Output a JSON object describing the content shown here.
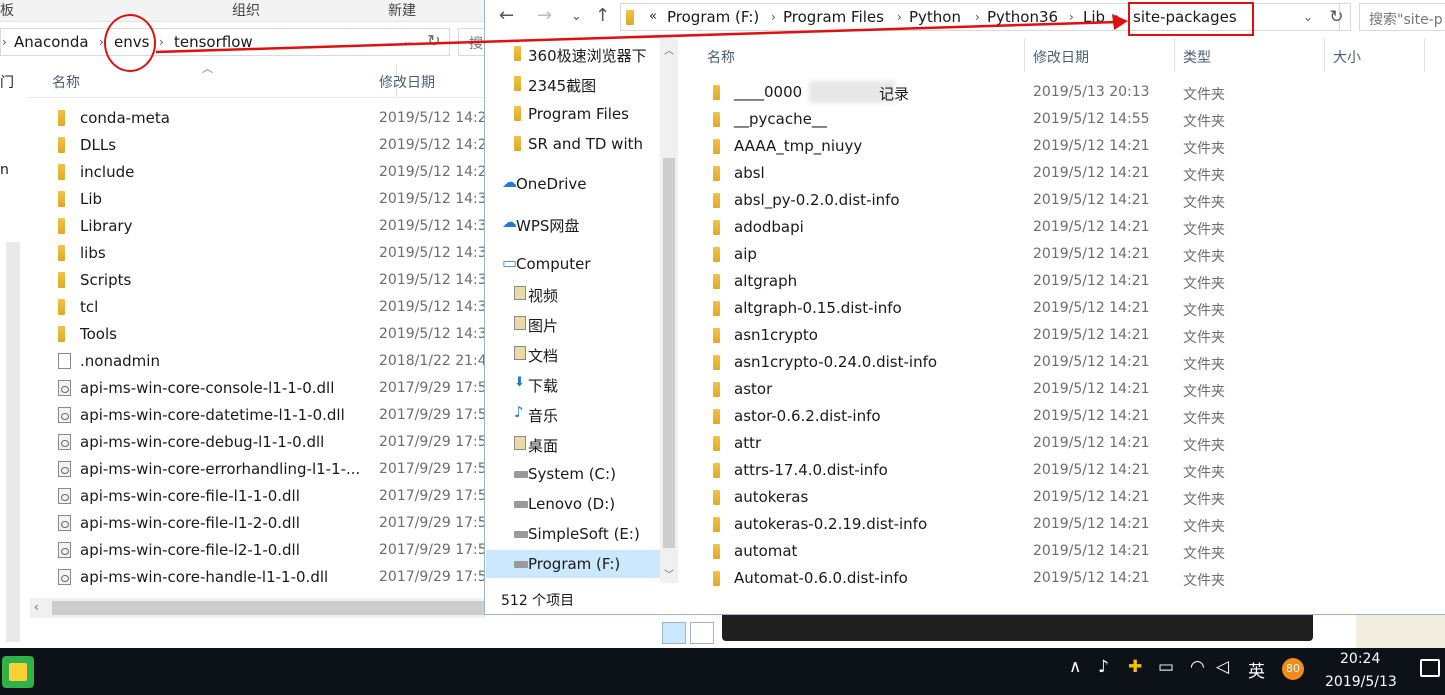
{
  "back_window": {
    "ribbon": {
      "left_partial": "板",
      "group": "组织",
      "new": "新建"
    },
    "breadcrumb": [
      "Anaconda",
      "envs",
      "tensorflow"
    ],
    "search_partial": "搜",
    "left_strip": {
      "top": "门",
      "mid": "n"
    },
    "columns": {
      "name": "名称",
      "date": "修改日期"
    },
    "rows": [
      {
        "name": "conda-meta",
        "date": "2019/5/12 14:2",
        "type": "folder"
      },
      {
        "name": "DLLs",
        "date": "2019/5/12 14:2",
        "type": "folder"
      },
      {
        "name": "include",
        "date": "2019/5/12 14:2",
        "type": "folder"
      },
      {
        "name": "Lib",
        "date": "2019/5/12 14:3",
        "type": "folder"
      },
      {
        "name": "Library",
        "date": "2019/5/12 14:3",
        "type": "folder"
      },
      {
        "name": "libs",
        "date": "2019/5/12 14:3",
        "type": "folder"
      },
      {
        "name": "Scripts",
        "date": "2019/5/12 14:3",
        "type": "folder"
      },
      {
        "name": "tcl",
        "date": "2019/5/12 14:3",
        "type": "folder"
      },
      {
        "name": "Tools",
        "date": "2019/5/12 14:3",
        "type": "folder"
      },
      {
        "name": ".nonadmin",
        "date": "2018/1/22 21:4",
        "type": "file"
      },
      {
        "name": "api-ms-win-core-console-l1-1-0.dll",
        "date": "2017/9/29 17:5",
        "type": "dll"
      },
      {
        "name": "api-ms-win-core-datetime-l1-1-0.dll",
        "date": "2017/9/29 17:5",
        "type": "dll"
      },
      {
        "name": "api-ms-win-core-debug-l1-1-0.dll",
        "date": "2017/9/29 17:5",
        "type": "dll"
      },
      {
        "name": "api-ms-win-core-errorhandling-l1-1-...",
        "date": "2017/9/29 17:5",
        "type": "dll"
      },
      {
        "name": "api-ms-win-core-file-l1-1-0.dll",
        "date": "2017/9/29 17:5",
        "type": "dll"
      },
      {
        "name": "api-ms-win-core-file-l1-2-0.dll",
        "date": "2017/9/29 17:5",
        "type": "dll"
      },
      {
        "name": "api-ms-win-core-file-l2-1-0.dll",
        "date": "2017/9/29 17:5",
        "type": "dll"
      },
      {
        "name": "api-ms-win-core-handle-l1-1-0.dll",
        "date": "2017/9/29 17:5",
        "type": "dll"
      }
    ]
  },
  "front_window": {
    "breadcrumb_prefix": "«",
    "breadcrumb": [
      "Program (F:)",
      "Program Files",
      "Python",
      "Python36",
      "Lib",
      "site-packages"
    ],
    "search_placeholder": "搜索\"site-p",
    "nav_items": [
      {
        "label": "360极速浏览器下",
        "icon": "folder-icon"
      },
      {
        "label": "2345截图",
        "icon": "folder-icon"
      },
      {
        "label": "Program Files",
        "icon": "folder-icon"
      },
      {
        "label": "SR and TD with",
        "icon": "folder-icon"
      },
      {
        "label": "OneDrive",
        "icon": "cloud-icon"
      },
      {
        "label": "WPS网盘",
        "icon": "cloud-icon"
      },
      {
        "label": "Computer",
        "icon": "computer-icon"
      },
      {
        "label": "视频",
        "icon": "video-icon"
      },
      {
        "label": "图片",
        "icon": "picture-icon"
      },
      {
        "label": "文档",
        "icon": "document-icon"
      },
      {
        "label": "下载",
        "icon": "download-icon"
      },
      {
        "label": "音乐",
        "icon": "music-icon"
      },
      {
        "label": "桌面",
        "icon": "desktop-icon"
      },
      {
        "label": "System (C:)",
        "icon": "drive-icon"
      },
      {
        "label": "Lenovo (D:)",
        "icon": "drive-icon"
      },
      {
        "label": "SimpleSoft (E:)",
        "icon": "drive-icon"
      },
      {
        "label": "Program (F:)",
        "icon": "drive-icon"
      }
    ],
    "columns": {
      "name": "名称",
      "date": "修改日期",
      "type": "类型",
      "size": "大小"
    },
    "rows": [
      {
        "name": "____0000",
        "name_suffix": "记录",
        "date": "2019/5/13 20:13",
        "type": "文件夹"
      },
      {
        "name": "__pycache__",
        "date": "2019/5/12 14:55",
        "type": "文件夹"
      },
      {
        "name": "AAAA_tmp_niuyy",
        "date": "2019/5/12 14:21",
        "type": "文件夹"
      },
      {
        "name": "absl",
        "date": "2019/5/12 14:21",
        "type": "文件夹"
      },
      {
        "name": "absl_py-0.2.0.dist-info",
        "date": "2019/5/12 14:21",
        "type": "文件夹"
      },
      {
        "name": "adodbapi",
        "date": "2019/5/12 14:21",
        "type": "文件夹"
      },
      {
        "name": "aip",
        "date": "2019/5/12 14:21",
        "type": "文件夹"
      },
      {
        "name": "altgraph",
        "date": "2019/5/12 14:21",
        "type": "文件夹"
      },
      {
        "name": "altgraph-0.15.dist-info",
        "date": "2019/5/12 14:21",
        "type": "文件夹"
      },
      {
        "name": "asn1crypto",
        "date": "2019/5/12 14:21",
        "type": "文件夹"
      },
      {
        "name": "asn1crypto-0.24.0.dist-info",
        "date": "2019/5/12 14:21",
        "type": "文件夹"
      },
      {
        "name": "astor",
        "date": "2019/5/12 14:21",
        "type": "文件夹"
      },
      {
        "name": "astor-0.6.2.dist-info",
        "date": "2019/5/12 14:21",
        "type": "文件夹"
      },
      {
        "name": "attr",
        "date": "2019/5/12 14:21",
        "type": "文件夹"
      },
      {
        "name": "attrs-17.4.0.dist-info",
        "date": "2019/5/12 14:21",
        "type": "文件夹"
      },
      {
        "name": "autokeras",
        "date": "2019/5/12 14:21",
        "type": "文件夹"
      },
      {
        "name": "autokeras-0.2.19.dist-info",
        "date": "2019/5/12 14:21",
        "type": "文件夹"
      },
      {
        "name": "automat",
        "date": "2019/5/12 14:21",
        "type": "文件夹"
      },
      {
        "name": "Automat-0.6.0.dist-info",
        "date": "2019/5/12 14:21",
        "type": "文件夹"
      }
    ],
    "status": "512 个项目"
  },
  "taskbar": {
    "ime": "英",
    "badge": "80",
    "time": "20:24",
    "date": "2019/5/13"
  },
  "colors": {
    "annotation": "#e01010",
    "selection": "#cce8ff",
    "folder": "#e8b53a",
    "taskbar": "#0d1219"
  }
}
